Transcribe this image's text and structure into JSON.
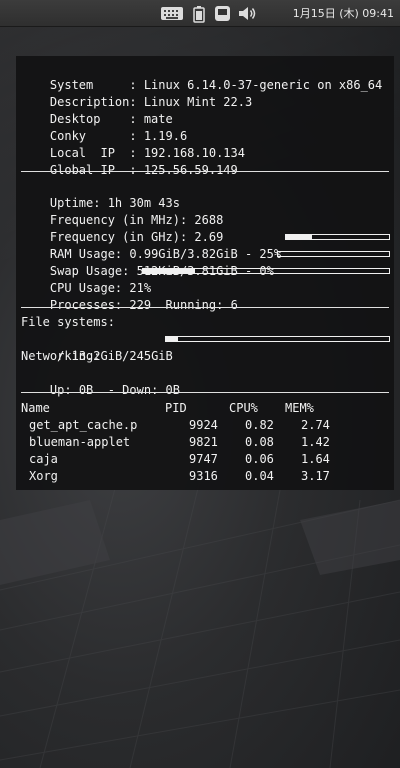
{
  "panel": {
    "clock": "1月15日 (木) 09:41",
    "icons": [
      "keyboard-icon",
      "battery-icon",
      "media-icon",
      "volume-icon"
    ]
  },
  "system": {
    "system_label": "System     : ",
    "system_value": "Linux 6.14.0-37-generic on x86_64",
    "description_label": "Description: ",
    "description_value": "Linux Mint 22.3",
    "desktop_label": "Desktop    : ",
    "desktop_value": "mate",
    "conky_label": "Conky      : ",
    "conky_value": "1.19.6",
    "local_ip_label": "Local  IP  : ",
    "local_ip_value": "192.168.10.134",
    "global_ip_label": "Global IP  : ",
    "global_ip_value": "125.56.59.149"
  },
  "stats": {
    "uptime_label": "Uptime: ",
    "uptime_value": "1h 30m 43s",
    "freq_mhz_label": "Frequency (in MHz): ",
    "freq_mhz_value": "2688",
    "freq_ghz_label": "Frequency (in GHz): ",
    "freq_ghz_value": "2.69",
    "ram_label": "RAM Usage: ",
    "ram_value": "0.99GiB/3.82GiB - 25%",
    "ram_percent": 25,
    "swap_label": "Swap Usage: ",
    "swap_value": "512KiB/3.81GiB - 0%",
    "swap_percent": 0,
    "cpu_label": "CPU Usage: ",
    "cpu_value": "21%",
    "cpu_percent": 21,
    "processes_label": "Processes: ",
    "processes_value": "229",
    "running_label": "  Running: ",
    "running_value": "6"
  },
  "filesystems": {
    "heading": "File systems:",
    "root_label": " / ",
    "root_value": "13.2GiB/245GiB",
    "root_percent": 5.4
  },
  "networking": {
    "heading": "Networking:",
    "up_label": "Up: ",
    "up_value": "0B",
    "down_label": "  - Down: ",
    "down_value": "0B"
  },
  "processes": {
    "headers": {
      "name": "Name",
      "pid": "PID",
      "cpu": "CPU%",
      "mem": "MEM%"
    },
    "rows": [
      {
        "name": "get_apt_cache.p",
        "pid": "9924",
        "cpu": "0.82",
        "mem": "2.74"
      },
      {
        "name": "blueman-applet",
        "pid": "9821",
        "cpu": "0.08",
        "mem": "1.42"
      },
      {
        "name": "caja",
        "pid": "9747",
        "cpu": "0.06",
        "mem": "1.64"
      },
      {
        "name": "Xorg",
        "pid": "9316",
        "cpu": "0.04",
        "mem": "3.17"
      }
    ]
  },
  "colors": {
    "panel": "#353535",
    "conky_bg": "#121213",
    "text": "#f2f2f2",
    "wallpaper": "#2e2f31"
  }
}
